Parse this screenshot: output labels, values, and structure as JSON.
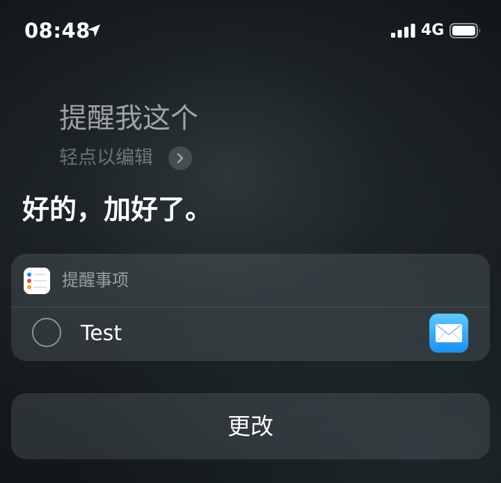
{
  "status_bar": {
    "time": "08:48",
    "network": "4G",
    "icons": [
      "location-arrow-icon",
      "cellular-signal-icon",
      "battery-icon"
    ]
  },
  "siri": {
    "request": "提醒我这个",
    "edit_hint": "轻点以编辑",
    "response": "好的，加好了。"
  },
  "reminder_card": {
    "app_name": "提醒事项",
    "app_icon": "reminders-app-icon",
    "item": {
      "title": "Test",
      "completed": false,
      "linked_app_icon": "mail-app-icon"
    }
  },
  "actions": {
    "change_label": "更改"
  },
  "colors": {
    "reminders_dot_blue": "#2f7cf6",
    "reminders_dot_red": "#f0443a",
    "reminders_dot_orange": "#f7a531",
    "mail_gradient_top": "#5fc8ff",
    "mail_gradient_bottom": "#1f8ef0"
  }
}
